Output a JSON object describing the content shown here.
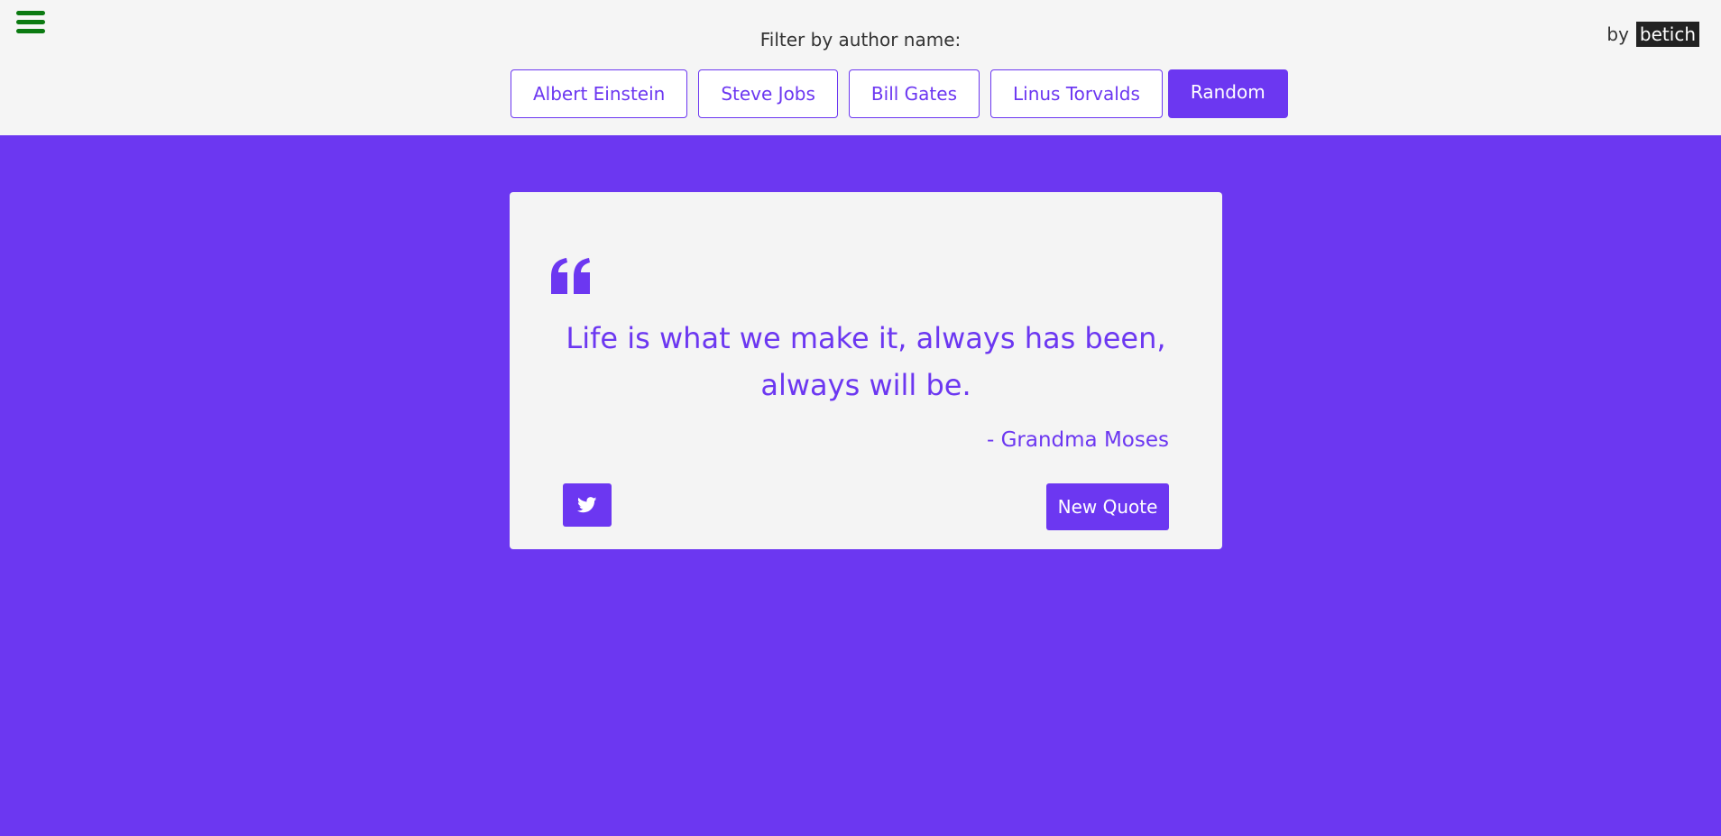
{
  "header": {
    "filter_label": "Filter by author name:",
    "filters": [
      {
        "label": "Albert Einstein",
        "active": false
      },
      {
        "label": "Steve Jobs",
        "active": false
      },
      {
        "label": "Bill Gates",
        "active": false
      },
      {
        "label": "Linus Torvalds",
        "active": false
      },
      {
        "label": "Random",
        "active": true
      }
    ],
    "by_prefix": "by",
    "brand": "betich"
  },
  "quote": {
    "text": "Life is what we make it, always has been, always will be.",
    "author": "- Grandma Moses"
  },
  "actions": {
    "tweet_icon": "twitter-icon",
    "new_quote_label": "New Quote"
  },
  "colors": {
    "accent": "#6c37f1",
    "header_bg": "#f5f5f5",
    "menu_icon": "#0b7a11",
    "card_bg": "#f4f4f4",
    "brand_bg": "#222222"
  },
  "icons": {
    "menu": "hamburger-menu-icon",
    "quote": "quote-left-icon",
    "twitter": "twitter-icon"
  }
}
